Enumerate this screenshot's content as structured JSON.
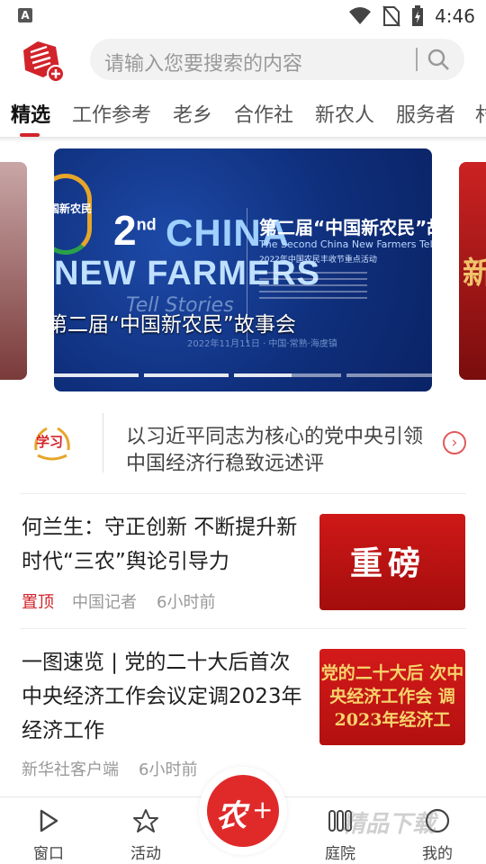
{
  "status_bar": {
    "app_badge": "A",
    "time": "4:46"
  },
  "header": {
    "search_placeholder": "请输入您要搜索的内容",
    "logo_plus": "+"
  },
  "tabs": [
    {
      "label": "精选",
      "active": true
    },
    {
      "label": "工作参考",
      "active": false
    },
    {
      "label": "老乡",
      "active": false
    },
    {
      "label": "合作社",
      "active": false
    },
    {
      "label": "新农人",
      "active": false
    },
    {
      "label": "服务者",
      "active": false
    },
    {
      "label": "村",
      "active": false
    }
  ],
  "carousel": {
    "right_card_text": "新",
    "banner": {
      "badge_text": "国新农民",
      "nd_number": "2",
      "nd_suffix": "nd",
      "china": "CHINA",
      "new_farmers": "NEW FARMERS",
      "tell_stories": "Tell Stories",
      "right_title": "第二届“中国新农民”故事",
      "right_subtitle_en": "The Second China New Farmers Tell Stor",
      "right_subtitle_cn": "2022年中国农民丰收节重点活动",
      "caption": "第二届“中国新农民”故事会",
      "date_line": "2022年11月11日 · 中国·常熟·海虞镇",
      "dot_count": 4,
      "active_dot": 0
    }
  },
  "study": {
    "badge_text": "学习",
    "headline": "以习近平同志为核心的党中央引领中国经济行稳致远述评",
    "arrow": "›"
  },
  "articles": [
    {
      "title": "何兰生：守正创新 不断提升新时代“三农”舆论引导力",
      "pinned": "置顶",
      "source": "中国记者",
      "time": "6小时前",
      "thumb_text": "重磅"
    },
    {
      "title": "一图速览 | 党的二十大后首次中央经济工作会议定调2023年经济工作",
      "pinned": "",
      "source": "新华社客户端",
      "time": "6小时前",
      "thumb_text": "党的二十大后 次中央经济工作会 调2023年经济工"
    }
  ],
  "tabbar": {
    "items": [
      {
        "label": "窗口",
        "icon": "play-icon"
      },
      {
        "label": "活动",
        "icon": "star-icon"
      },
      {
        "label": "庭院",
        "icon": "courtyard-icon"
      },
      {
        "label": "我的",
        "icon": "profile-icon"
      }
    ],
    "fab_text": "农",
    "fab_plus": "+"
  },
  "watermark": "精品下载",
  "colors": {
    "accent": "#d2232a",
    "banner_blue": "#0f2f7c",
    "fab_red": "#e02a2a"
  }
}
